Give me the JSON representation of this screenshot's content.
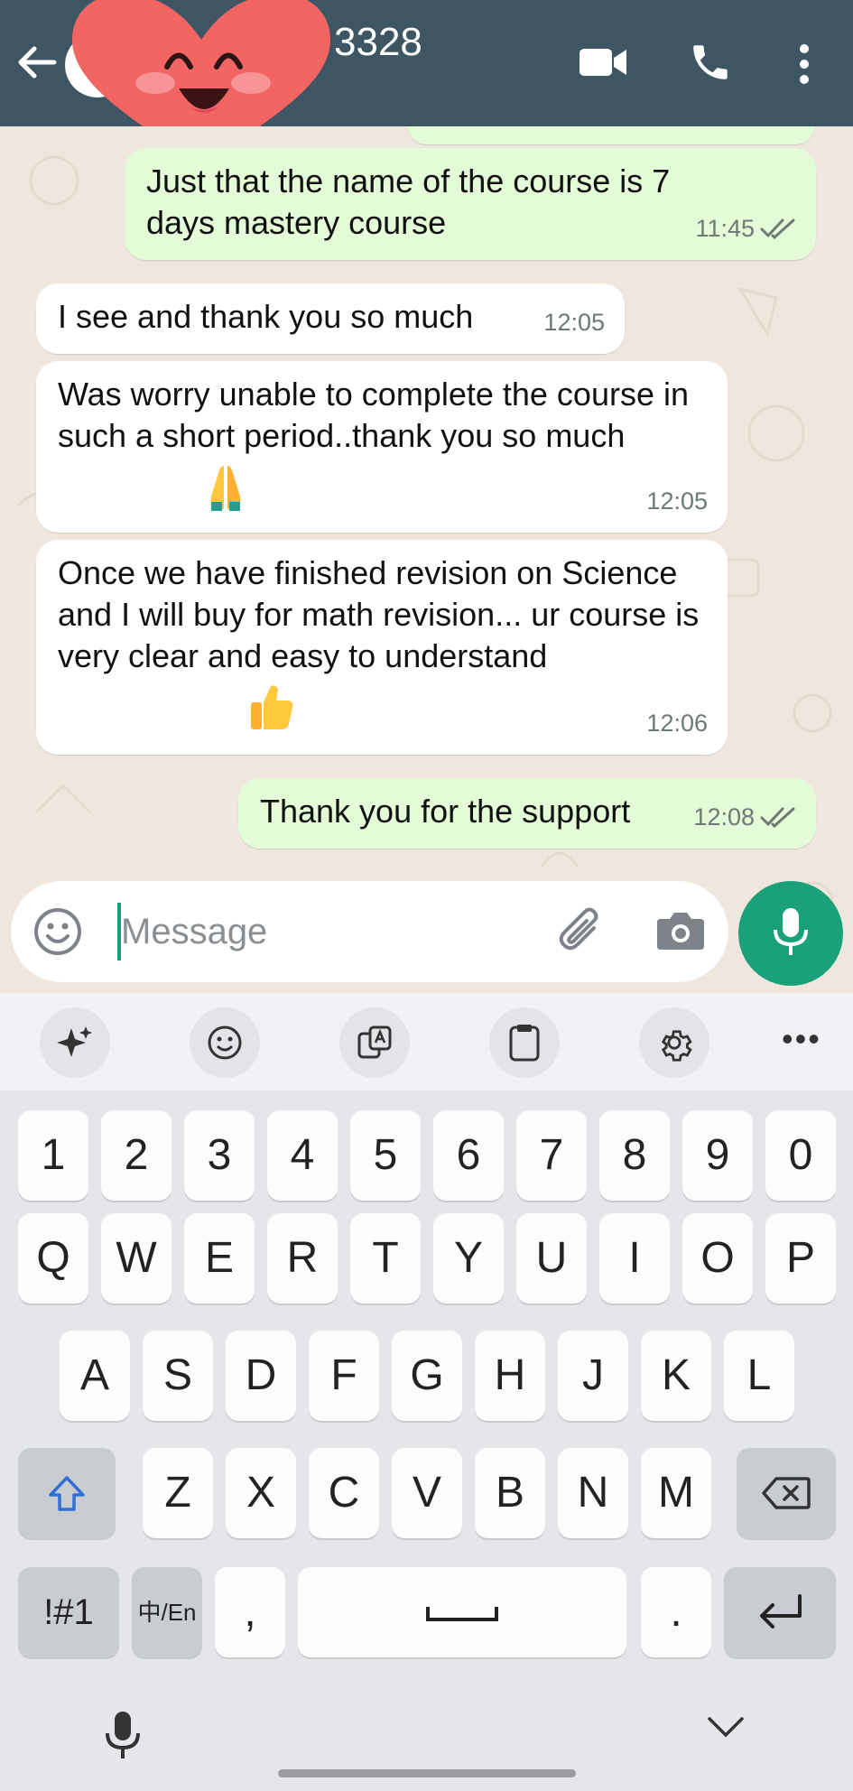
{
  "header": {
    "title": "3328"
  },
  "messages": [
    {
      "text": "Just that the name of the course is 7 days mastery course",
      "time": "11:45"
    },
    {
      "text": "I see and thank you so much",
      "time": "12:05"
    },
    {
      "text": "Was worry unable to complete the course in such a short period..thank you so much",
      "time": "12:05",
      "emoji": "folded-hands"
    },
    {
      "text": "Once we have finished revision on Science and I will buy for math revision... ur course  is very clear and easy to understand",
      "time": "12:06",
      "emoji": "thumbs-up"
    },
    {
      "text": "Thank you for the support",
      "time": "12:08"
    }
  ],
  "composer": {
    "placeholder": "Message"
  },
  "keyboard": {
    "numbers": [
      "1",
      "2",
      "3",
      "4",
      "5",
      "6",
      "7",
      "8",
      "9",
      "0"
    ],
    "row1": [
      "Q",
      "W",
      "E",
      "R",
      "T",
      "Y",
      "U",
      "I",
      "O",
      "P"
    ],
    "row2": [
      "A",
      "S",
      "D",
      "F",
      "G",
      "H",
      "J",
      "K",
      "L"
    ],
    "row3": [
      "Z",
      "X",
      "C",
      "V",
      "B",
      "N",
      "M"
    ],
    "symbols": "!#1",
    "lang": "中/En",
    "comma": ",",
    "period": "."
  },
  "colors": {
    "header": "#3e5663",
    "outgoing": "#e3fbd7",
    "incoming": "#ffffff",
    "accent": "#1aa179",
    "chat_bg": "#efe7de"
  },
  "icons": [
    "back-arrow-icon",
    "video-call-icon",
    "phone-icon",
    "more-vert-icon",
    "heart-sticker",
    "emoji-icon",
    "attach-icon",
    "camera-icon",
    "mic-icon",
    "sparkle-icon",
    "clipboard-icon",
    "settings-icon",
    "shift-icon",
    "backspace-icon",
    "enter-icon",
    "space-icon",
    "chevron-down-icon"
  ]
}
